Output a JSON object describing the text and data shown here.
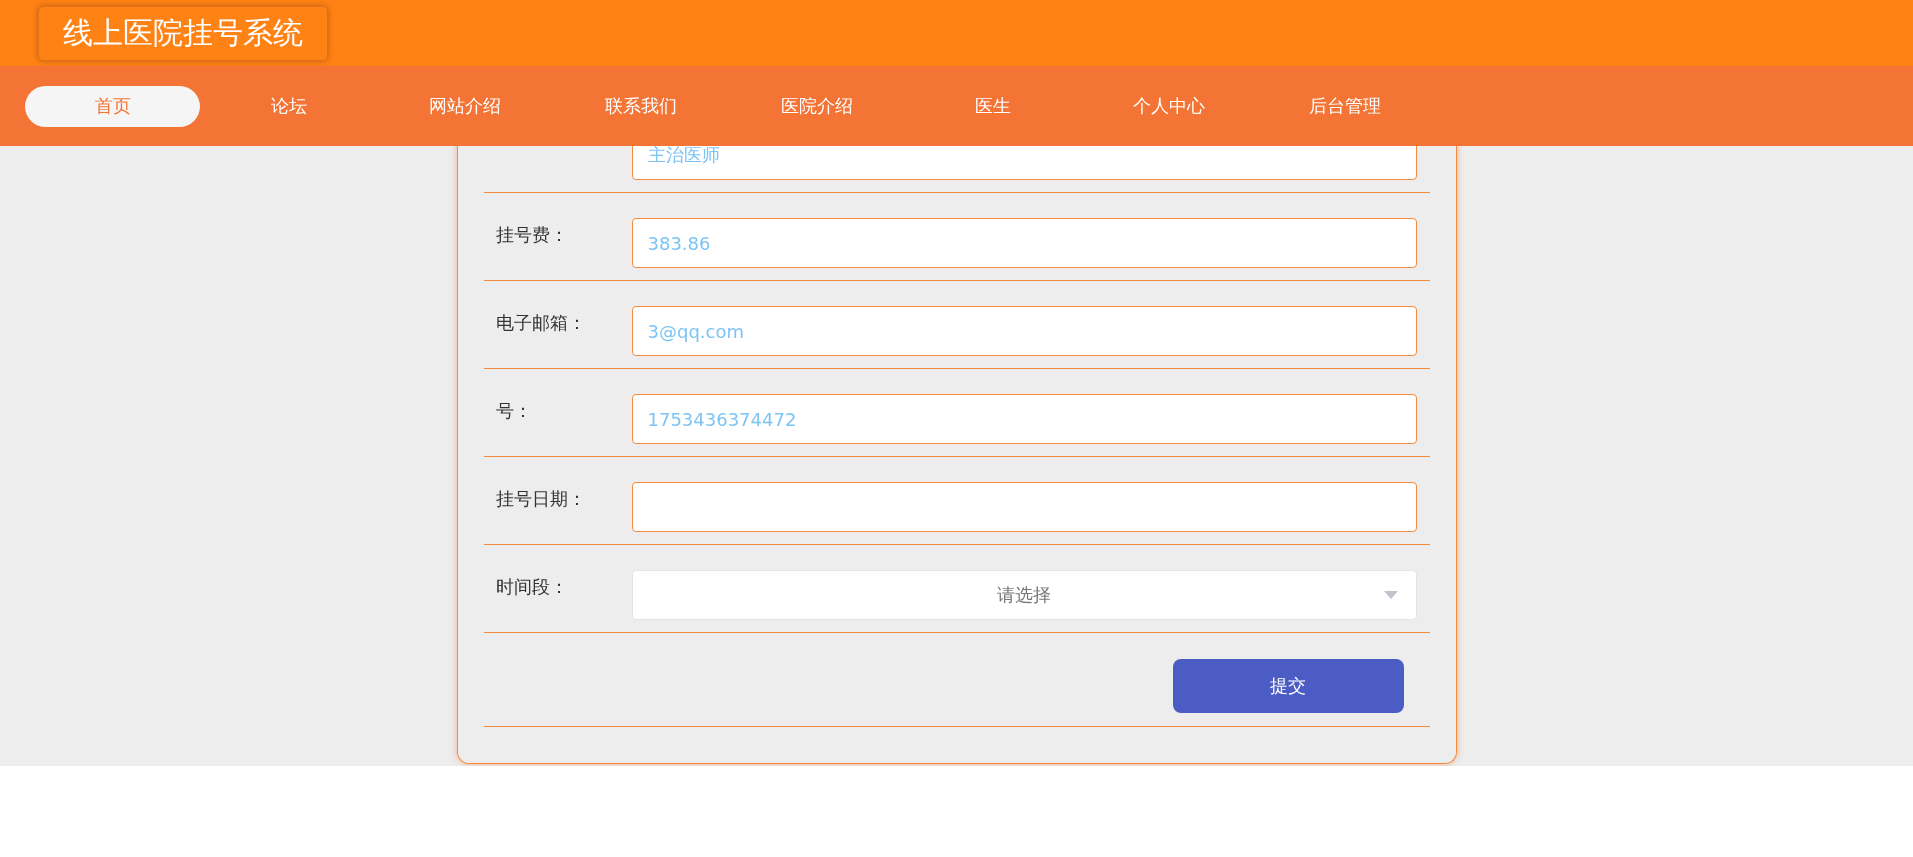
{
  "header": {
    "title": "线上医院挂号系统"
  },
  "nav": [
    {
      "label": "首页",
      "selected": true
    },
    {
      "label": "论坛",
      "selected": false
    },
    {
      "label": "网站介绍",
      "selected": false
    },
    {
      "label": "联系我们",
      "selected": false
    },
    {
      "label": "医院介绍",
      "selected": false
    },
    {
      "label": "医生",
      "selected": false
    },
    {
      "label": "个人中心",
      "selected": false
    },
    {
      "label": "后台管理",
      "selected": false
    }
  ],
  "form": {
    "fields": [
      {
        "kind": "text",
        "value": "主治医师"
      },
      {
        "kind": "text",
        "label": "挂号费：",
        "value": "383.86"
      },
      {
        "kind": "text",
        "label": "电子邮箱：",
        "value": "3@qq.com"
      },
      {
        "kind": "text",
        "label": "号：",
        "value": "1753436374472"
      },
      {
        "kind": "text",
        "label": "挂号日期："
      },
      {
        "kind": "select",
        "label": "时间段：",
        "placeholder": "请选择"
      }
    ],
    "submit": "提交"
  }
}
